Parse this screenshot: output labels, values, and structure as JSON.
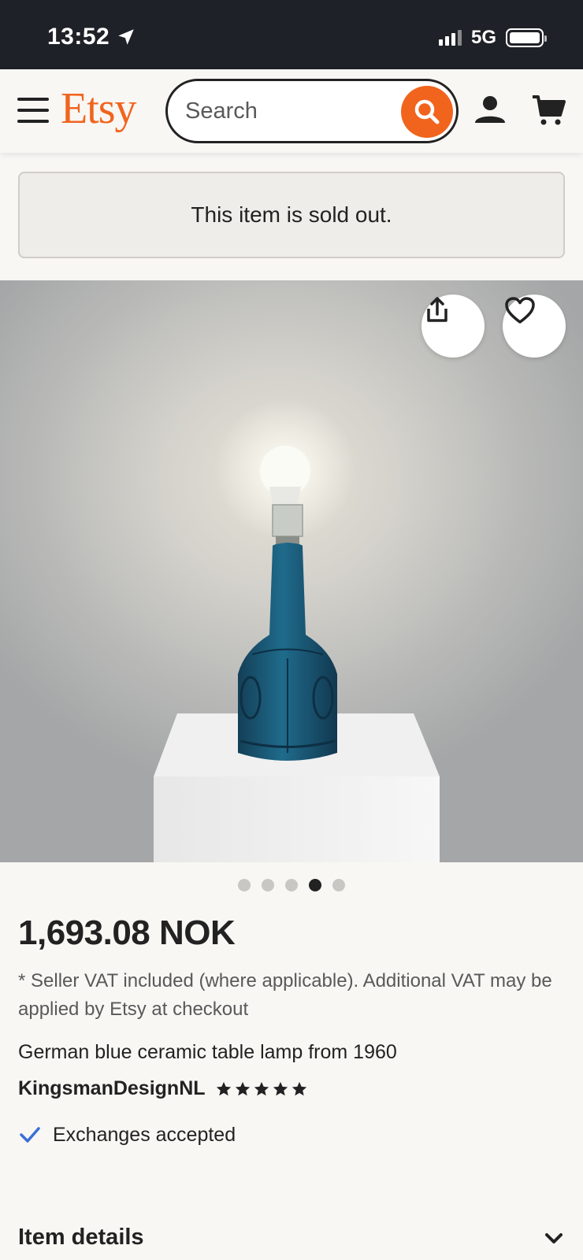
{
  "status_bar": {
    "time": "13:52",
    "network": "5G",
    "icons": [
      "location-arrow-icon",
      "signal-icon",
      "battery-icon"
    ]
  },
  "header": {
    "logo": "Etsy",
    "search_placeholder": "Search",
    "icons": [
      "menu-icon",
      "search-icon",
      "account-icon",
      "cart-icon"
    ]
  },
  "banner": {
    "text": "This item is sold out."
  },
  "gallery": {
    "image_count": 5,
    "active_index": 3,
    "actions": [
      "share-icon",
      "heart-icon"
    ]
  },
  "product": {
    "price": "1,693.08 NOK",
    "vat_note": "* Seller VAT included (where applicable). Additional VAT may be applied by Etsy at checkout",
    "title": "German blue ceramic table lamp from 1960",
    "shop_name": "KingsmanDesignNL",
    "rating_stars": 5,
    "exchanges": "Exchanges accepted"
  },
  "sections": {
    "item_details": "Item details"
  },
  "colors": {
    "brand": "#f1641e",
    "text": "#222222",
    "check": "#3a6fd8"
  }
}
